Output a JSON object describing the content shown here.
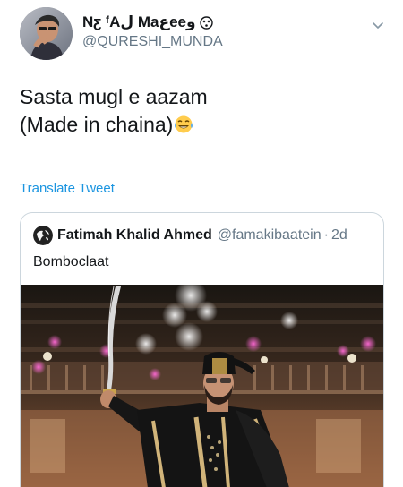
{
  "tweet": {
    "author": {
      "display_name": "Nƹ ᶠAل Maعeeو",
      "handle": "@QURESHI_MUNDA",
      "name_emoji": "dizzy-face-emoji"
    },
    "text_line1": "Sasta mugl e aazam",
    "text_line2": "(Made in chaina)",
    "text_emoji": "tears-of-joy-emoji",
    "translate_label": "Translate Tweet",
    "menu_icon": "chevron-down-icon"
  },
  "quoted": {
    "author_name": "Fatimah Khalid Ahmed",
    "handle": "@famakibaatein",
    "separator": "·",
    "time": "2d",
    "text": "Bomboclaat",
    "media_description_icon": "photo"
  },
  "colors": {
    "link_blue": "#1b95e0",
    "secondary_text": "#657786",
    "border": "#ccd6dd"
  }
}
